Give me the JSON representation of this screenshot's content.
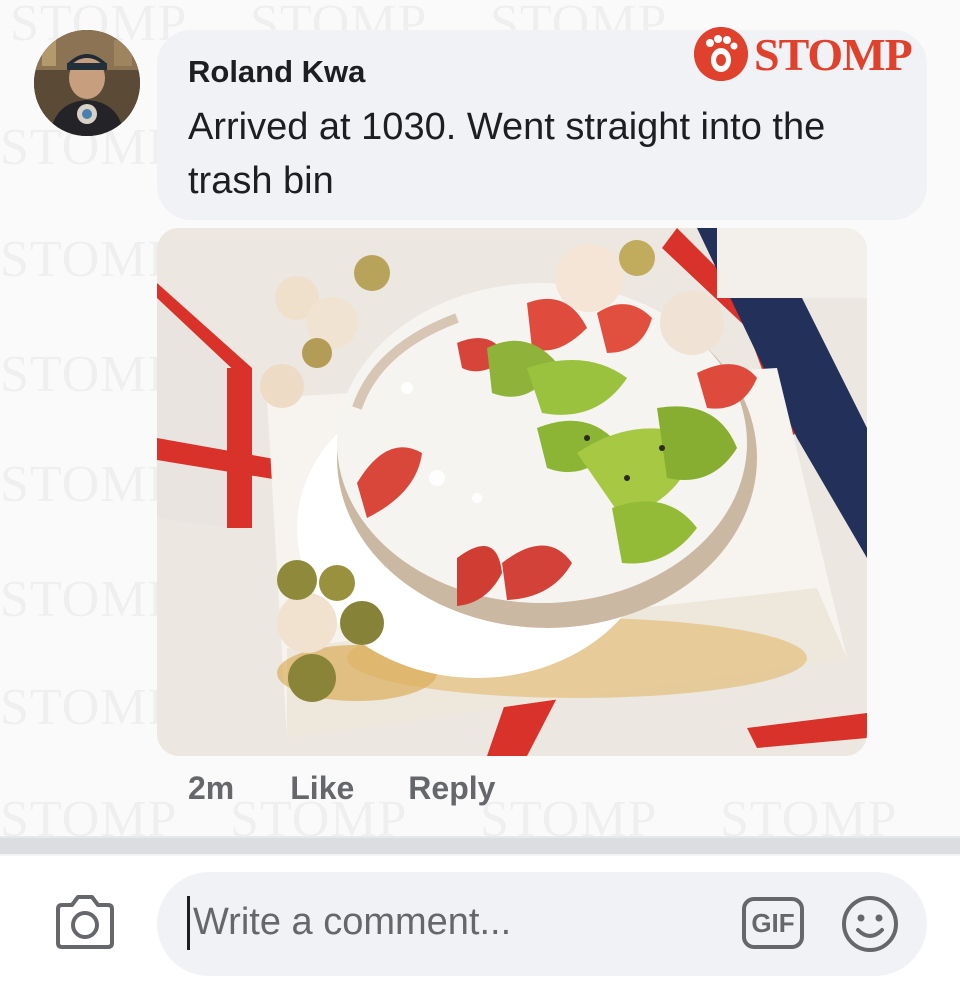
{
  "comment": {
    "author": "Roland Kwa",
    "text": "Arrived at 1030. Went straight into the trash bin",
    "timestamp": "2m",
    "like_label": "Like",
    "reply_label": "Reply"
  },
  "brand": {
    "name": "STOMP",
    "watermark_text": "STOMP",
    "color": "#e0412c"
  },
  "composer": {
    "placeholder": "Write a comment...",
    "gif_label": "GIF",
    "camera_icon": "camera-icon",
    "emoji_icon": "smiley-face-icon"
  },
  "colors": {
    "bubble": "#f0f2f5",
    "secondary_text": "#65676b",
    "primary_text": "#1c1e21"
  }
}
